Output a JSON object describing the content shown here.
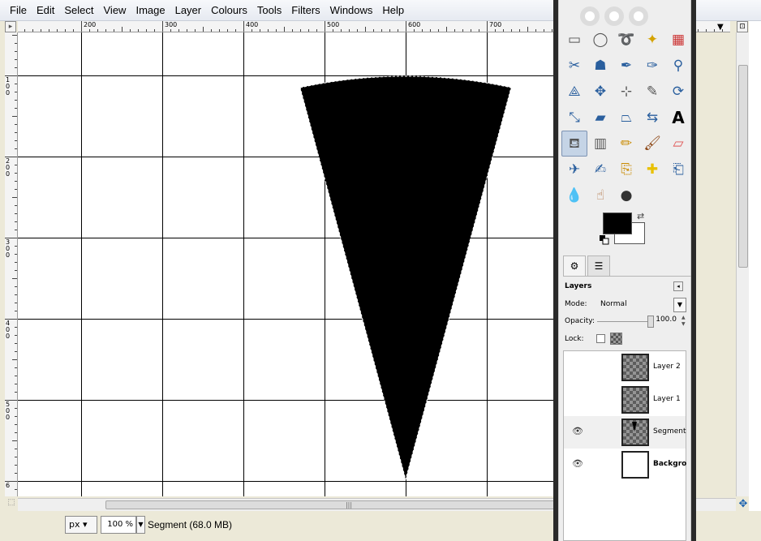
{
  "menu": [
    "File",
    "Edit",
    "Select",
    "View",
    "Image",
    "Layer",
    "Colours",
    "Tools",
    "Filters",
    "Windows",
    "Help"
  ],
  "ruler": {
    "h_labels": [
      "200",
      "300",
      "400",
      "500",
      "600",
      "700"
    ],
    "v_labels": [
      "100",
      "200",
      "300",
      "400",
      "500",
      "6"
    ]
  },
  "statusbar": {
    "unit": "px",
    "zoom": "100 %",
    "status": "Segment (68.0 MB)"
  },
  "toolbox": {
    "foreground_color": "#000000",
    "background_color": "#ffffff",
    "tools": [
      "rect-select-icon",
      "ellipse-select-icon",
      "free-select-icon",
      "fuzzy-select-icon",
      "select-by-color-icon",
      "scissors-select-icon",
      "foreground-select-icon",
      "paths-icon",
      "color-picker-icon",
      "zoom-icon",
      "measure-icon",
      "move-icon",
      "align-icon",
      "crop-icon",
      "rotate-icon",
      "scale-icon",
      "shear-icon",
      "perspective-icon",
      "flip-icon",
      "text-icon",
      "bucket-fill-icon",
      "blend-icon",
      "pencil-icon",
      "paintbrush-icon",
      "eraser-icon",
      "airbrush-icon",
      "ink-icon",
      "clone-icon",
      "heal-icon",
      "perspective-clone-icon",
      "blur-icon",
      "smudge-icon",
      "dodge-burn-icon"
    ],
    "active_tool": "bucket-fill-icon"
  },
  "layers": {
    "title": "Layers",
    "mode_label": "Mode:",
    "mode_value": "Normal",
    "opacity_label": "Opacity:",
    "opacity_value": "100.0",
    "lock_label": "Lock:",
    "items": [
      {
        "name": "Layer 2",
        "visible": false,
        "thumb": "transparent"
      },
      {
        "name": "Layer 1",
        "visible": false,
        "thumb": "transparent"
      },
      {
        "name": "Segment",
        "visible": true,
        "thumb": "segment"
      },
      {
        "name": "Backgrou",
        "visible": true,
        "thumb": "white"
      }
    ]
  },
  "canvas": {
    "shape_fill": "#000000",
    "grid_color": "#000000"
  }
}
